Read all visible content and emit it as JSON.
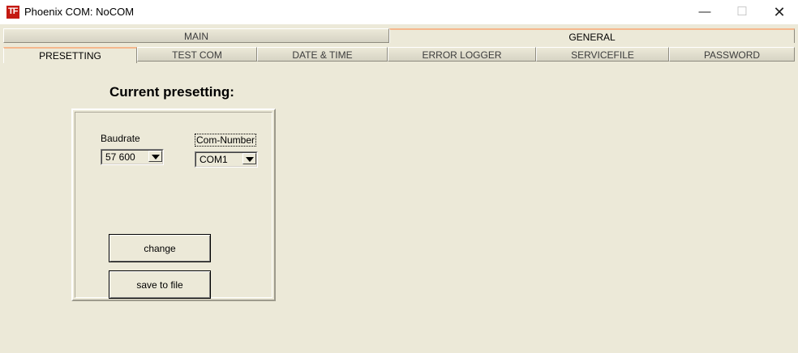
{
  "window": {
    "title": "Phoenix COM: NoCOM",
    "icon_glyph": "TF",
    "minimize_glyph": "—",
    "maximize_glyph": "☐",
    "close_glyph": "✕"
  },
  "tabs_row1": [
    {
      "label": "MAIN",
      "active": false
    },
    {
      "label": "GENERAL",
      "active": true
    }
  ],
  "tabs_row2": [
    {
      "label": "PRESETTING",
      "active": true
    },
    {
      "label": "TEST COM",
      "active": false
    },
    {
      "label": "DATE & TIME",
      "active": false
    },
    {
      "label": "ERROR LOGGER",
      "active": false
    },
    {
      "label": "SERVICEFILE",
      "active": false
    },
    {
      "label": "PASSWORD",
      "active": false
    }
  ],
  "presetting": {
    "heading": "Current presetting:",
    "baudrate_label": "Baudrate",
    "baudrate_value": "57 600",
    "com_label": "Com-Number",
    "com_value": "COM1",
    "change_label": "change",
    "save_label": "save to file"
  },
  "colors": {
    "panel_bg": "#ece9d8",
    "active_tab_accent": "#f5b78d",
    "app_icon_red": "#c41a12"
  }
}
